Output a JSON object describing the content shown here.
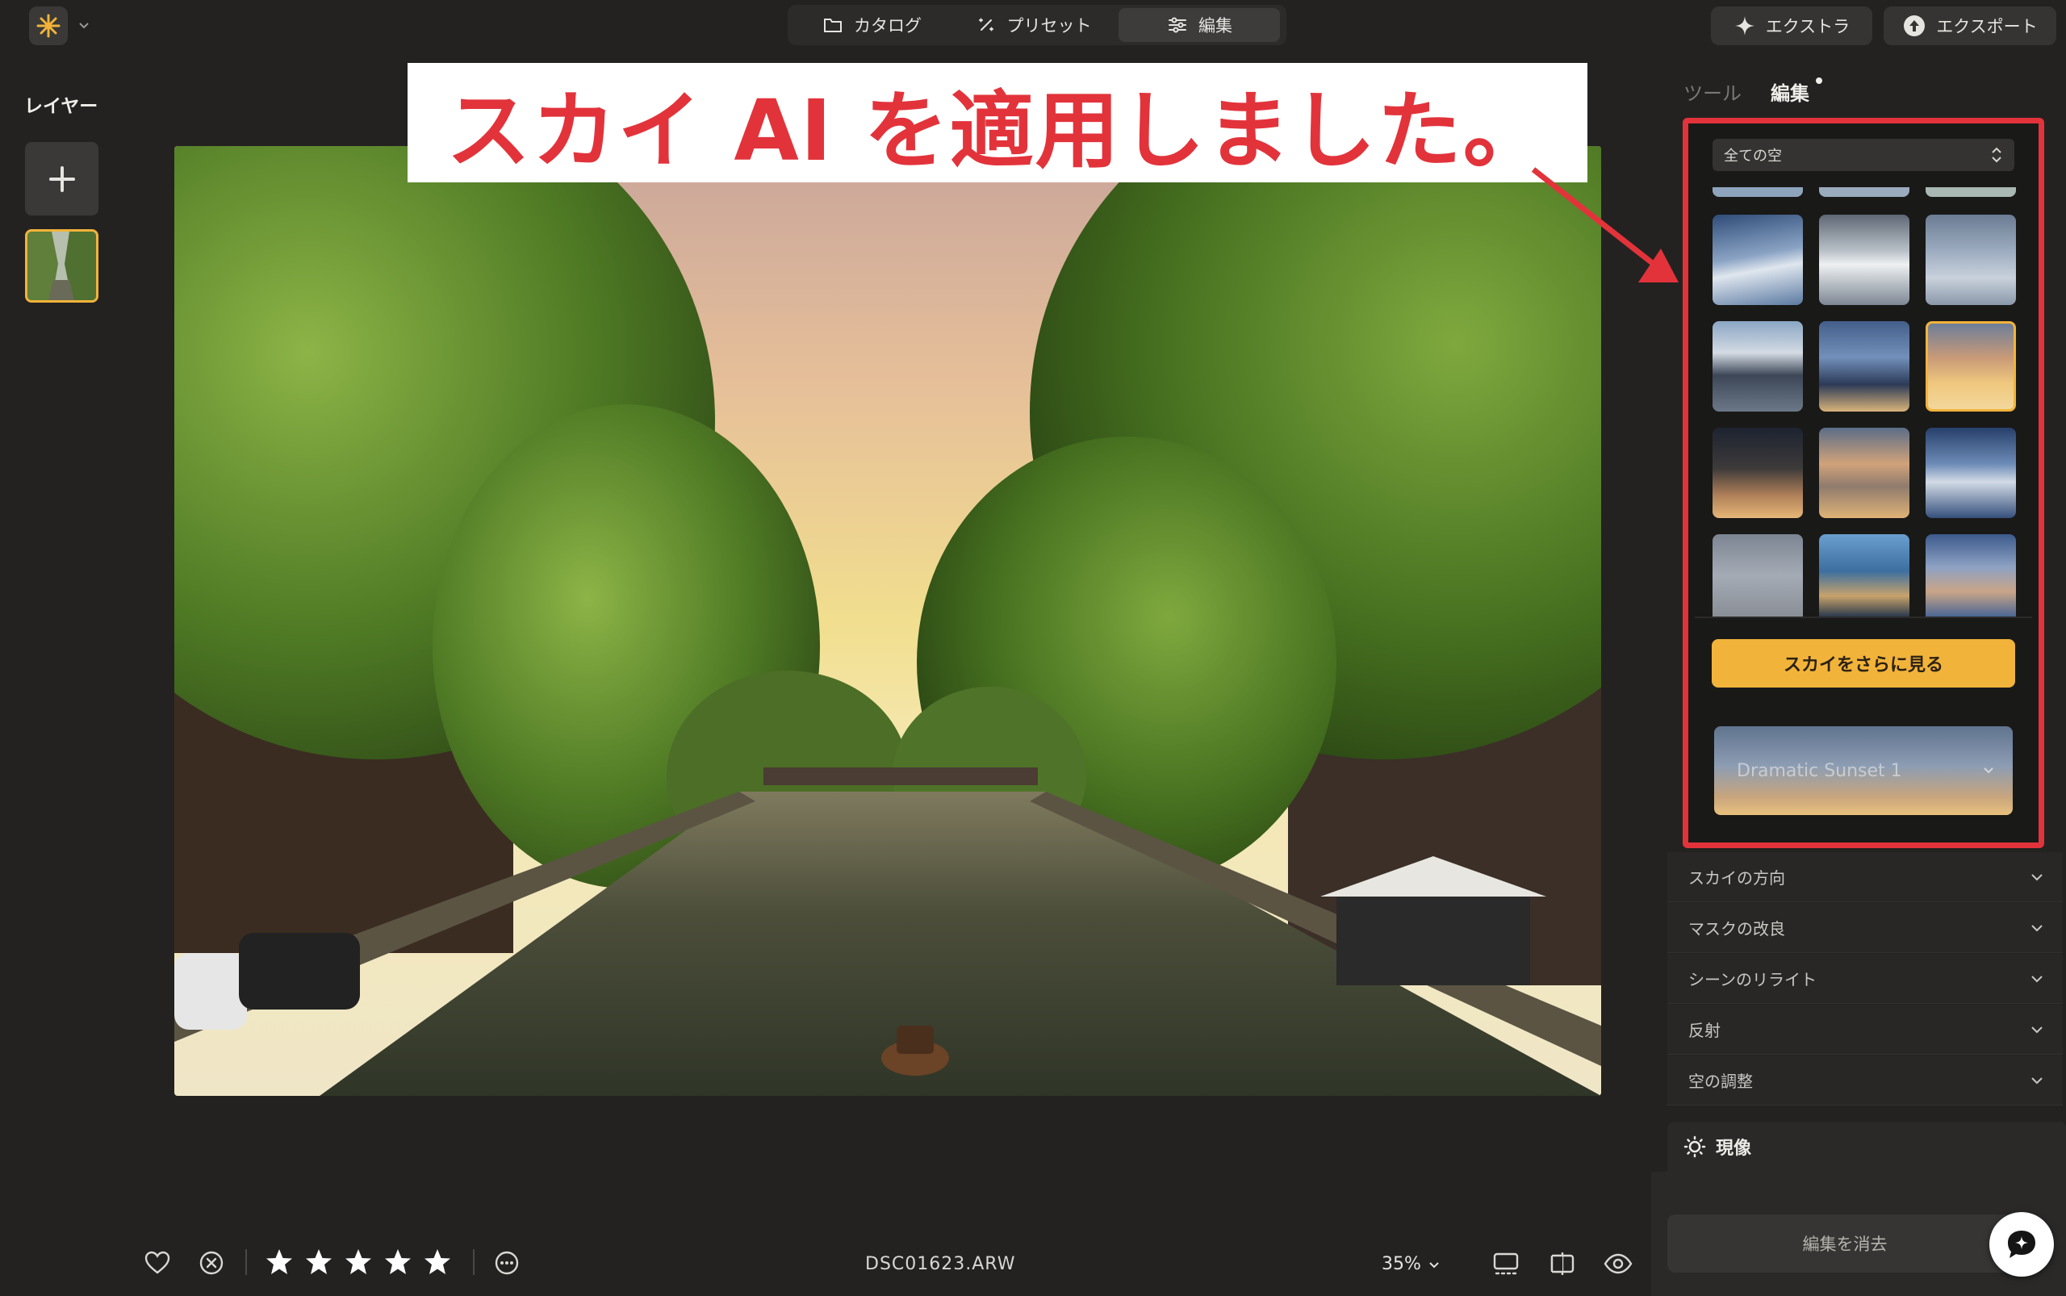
{
  "topbar": {
    "tabs": [
      {
        "label": "カタログ",
        "icon": "folder-icon"
      },
      {
        "label": "プリセット",
        "icon": "sparkle-wand-icon"
      },
      {
        "label": "編集",
        "icon": "sliders-icon",
        "active": true
      }
    ],
    "extras_label": "エクストラ",
    "export_label": "エクスポート"
  },
  "layers": {
    "title": "レイヤー"
  },
  "annotation": {
    "text": "スカイ AI を適用しました。",
    "color": "#e2333b"
  },
  "panel": {
    "tabs": [
      {
        "label": "ツール",
        "active": false
      },
      {
        "label": "編集",
        "active": true
      }
    ],
    "sky_filter": "全ての空",
    "more_skies_label": "スカイをさらに見る",
    "current_sky": "Dramatic Sunset 1",
    "sections": [
      "スカイの方向",
      "マスクの改良",
      "シーンのリライト",
      "反射",
      "空の調整"
    ],
    "develop_label": "現像",
    "clear_edits_label": "編集を消去"
  },
  "bottombar": {
    "rating": 5,
    "filename": "DSC01623.ARW",
    "zoom": "35%"
  },
  "colors": {
    "accent": "#f2b33a",
    "background": "#232221",
    "panel": "#282726",
    "highlight": "#e2333b"
  }
}
